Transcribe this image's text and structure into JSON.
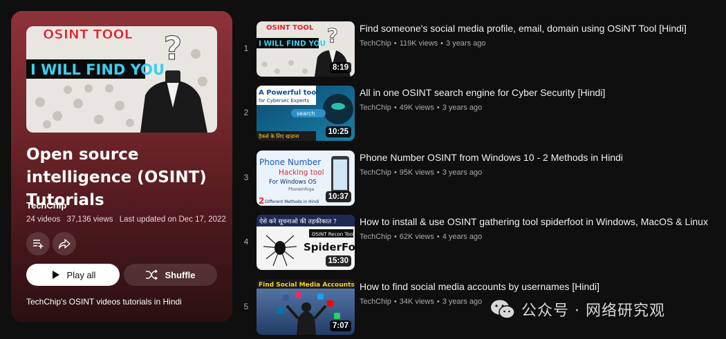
{
  "playlist": {
    "cover": {
      "banner_top": "OSINT TOOL",
      "banner_mid": "I WILL FIND YOU"
    },
    "title": "Open source intelligence (OSINT) Tutorials",
    "channel": "TechChip",
    "video_count": "24 videos",
    "views": "37,136 views",
    "last_updated": "Last updated on Dec 17, 2022",
    "play_all_label": "Play all",
    "shuffle_label": "Shuffle",
    "description": "TechChip's OSINT videos tutorials in Hindi",
    "icons": [
      "add-to-queue-icon",
      "share-icon",
      "play-icon",
      "shuffle-icon"
    ]
  },
  "videos": [
    {
      "index": "1",
      "title": "Find someone's social media profile, email, domain using OSiNT Tool [Hindi]",
      "channel": "TechChip",
      "views": "119K views",
      "age": "3 years ago",
      "duration": "8:19",
      "thumb_text": [
        "OSINT TOOL",
        "I WILL FIND YOU"
      ]
    },
    {
      "index": "2",
      "title": "All in one OSINT search engine for Cyber Security [Hindi]",
      "channel": "TechChip",
      "views": "49K views",
      "age": "3 years ago",
      "duration": "10:25",
      "thumb_text": [
        "A Powerful tool",
        "for Cybersec Experts",
        "search",
        "हैकर्स के लिए खज़ाना"
      ]
    },
    {
      "index": "3",
      "title": "Phone Number OSINT from Windows 10 - 2 Methods in Hindi",
      "channel": "TechChip",
      "views": "95K views",
      "age": "3 years ago",
      "duration": "10:37",
      "thumb_text": [
        "Phone Number",
        "Hacking tool",
        "For Windows OS",
        "Phoneinfoga",
        "2",
        "Different Methods in Hindi"
      ]
    },
    {
      "index": "4",
      "title": "How to install & use OSINT gathering tool spiderfoot in Windows, MacOS & Linux",
      "channel": "TechChip",
      "views": "62K views",
      "age": "4 years ago",
      "duration": "15:30",
      "thumb_text": [
        "ऐसे करे सूचनाओ की तहकीकात ?",
        "OSINT Recon Tool",
        "SpiderFoot"
      ]
    },
    {
      "index": "5",
      "title": "How to find social media accounts by usernames [Hindi]",
      "channel": "TechChip",
      "views": "34K views",
      "age": "3 years ago",
      "duration": "7:07",
      "thumb_text": [
        "Find Social Media Accounts"
      ]
    }
  ],
  "separator": "•",
  "watermark": {
    "text": "公众号 · 网络研究观",
    "icon": "wechat-icon"
  }
}
